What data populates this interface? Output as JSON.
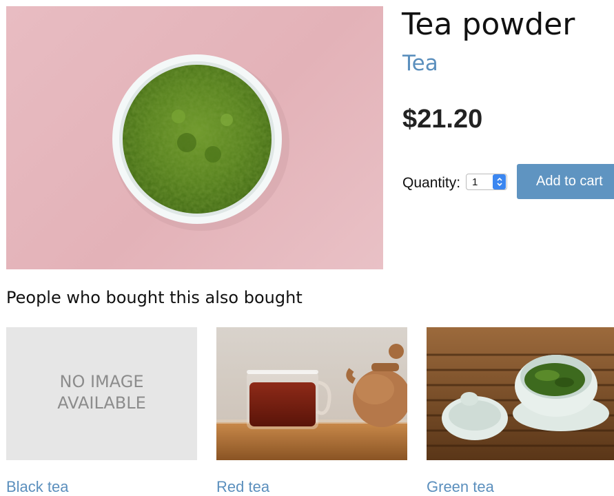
{
  "product": {
    "title": "Tea powder",
    "category": "Tea",
    "price": "$21.20",
    "quantity_label": "Quantity:",
    "quantity_value": "1",
    "add_to_cart_label": "Add to cart"
  },
  "recommendations": {
    "heading": "People who bought this also bought",
    "no_image_line1": "NO IMAGE",
    "no_image_line2": "AVAILABLE",
    "items": [
      {
        "name": "Black tea"
      },
      {
        "name": "Red tea"
      },
      {
        "name": "Green tea"
      }
    ]
  },
  "colors": {
    "accent": "#5f94c1",
    "link": "#5b8fbd",
    "select_arrow": "#3b86f0"
  }
}
